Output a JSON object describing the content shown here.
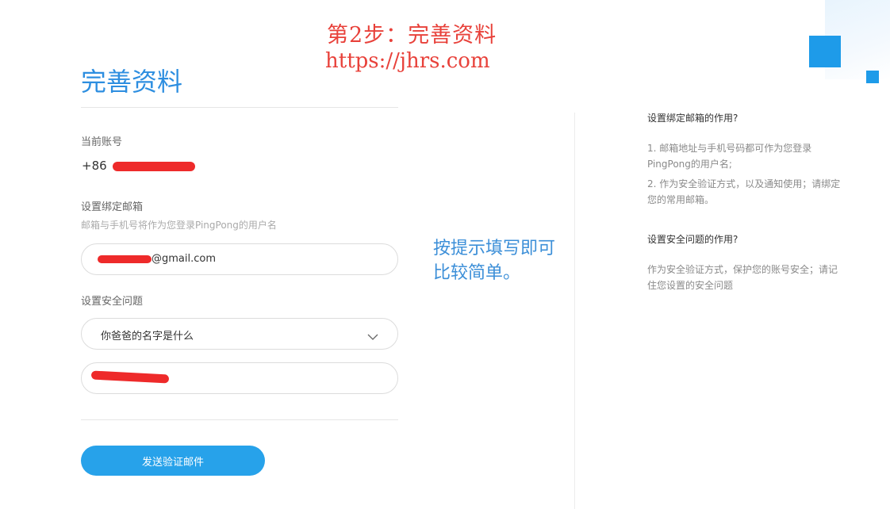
{
  "overlay": {
    "step": "第2步：完善资料",
    "url": "https://jhrs.com"
  },
  "form": {
    "title": "完善资料",
    "account_label": "当前账号",
    "account_prefix": "+86",
    "email_label": "设置绑定邮箱",
    "email_hint": "邮箱与手机号将作为您登录PingPong的用户名",
    "email_value": "@gmail.com",
    "question_label": "设置安全问题",
    "question_selected": "你爸爸的名字是什么",
    "answer_value": "",
    "submit_label": "发送验证邮件"
  },
  "annotation": {
    "line1": "按提示填写即可",
    "line2": "比较简单。"
  },
  "help": {
    "email_title": "设置绑定邮箱的作用?",
    "email_point1": "1. 邮箱地址与手机号码都可作为您登录PingPong的用户名;",
    "email_point2": "2. 作为安全验证方式，以及通知使用；请绑定您的常用邮箱。",
    "question_title": "设置安全问题的作用?",
    "question_text": "作为安全验证方式，保护您的账号安全；请记住您设置的安全问题"
  },
  "colors": {
    "brand_blue": "#27a2ea",
    "title_blue": "#2d8ee0",
    "overlay_red": "#e8413a",
    "redaction_red": "#ee2a2a"
  },
  "icons": {
    "dropdown": "chevron-down-icon"
  }
}
